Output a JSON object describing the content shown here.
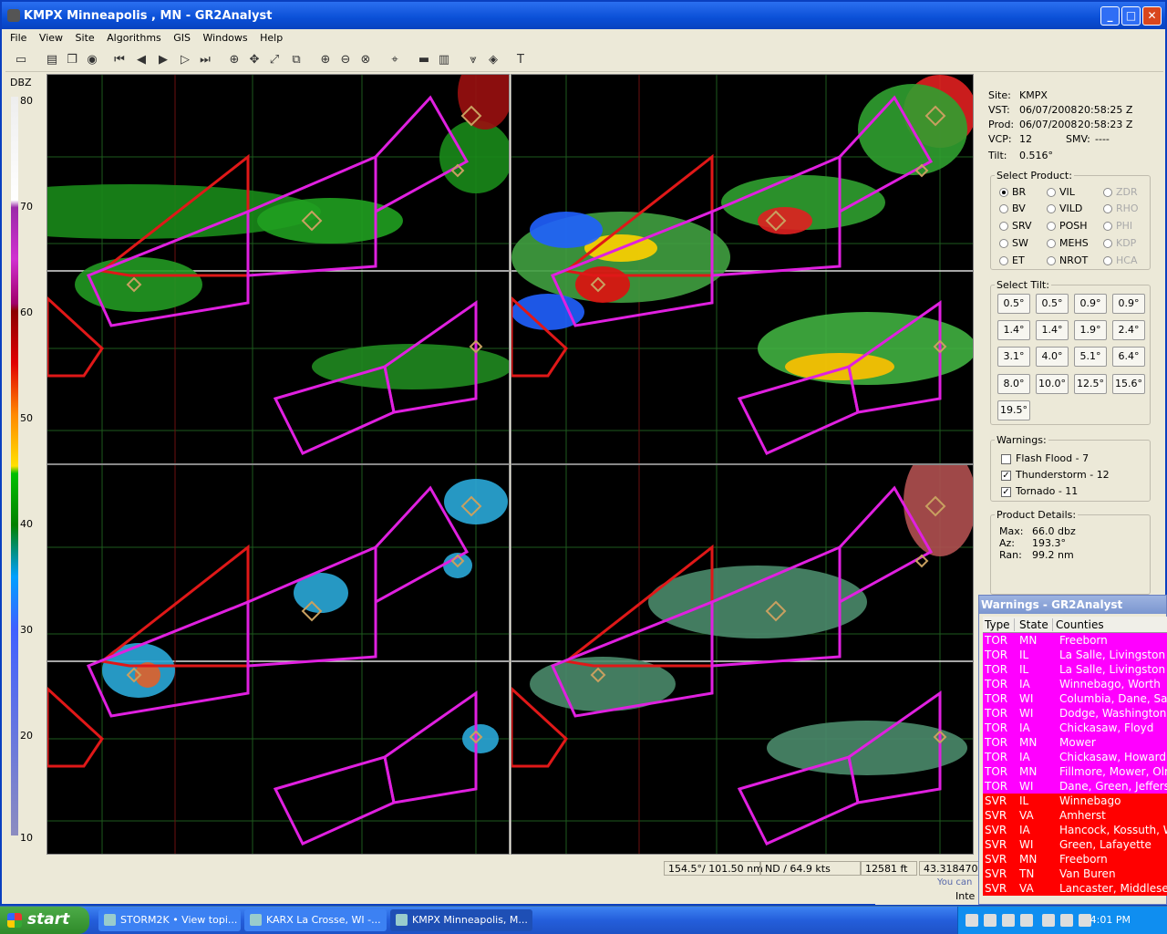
{
  "window": {
    "title": "KMPX Minneapolis , MN - GR2Analyst",
    "btn_min": "_",
    "btn_max": "□",
    "btn_close": "✕"
  },
  "menu": [
    "File",
    "View",
    "Site",
    "Algorithms",
    "GIS",
    "Windows",
    "Help"
  ],
  "scale": {
    "label": "DBZ",
    "ticks": [
      "80",
      "70",
      "60",
      "50",
      "40",
      "30",
      "20",
      "10"
    ]
  },
  "info": {
    "site_label": "Site:",
    "site": "KMPX",
    "vst_label": "VST:",
    "vst_date": "06/07/2008",
    "vst_time": "20:58:25 Z",
    "prod_label": "Prod:",
    "prod_date": "06/07/2008",
    "prod_time": "20:58:23 Z",
    "vcp_label": "VCP:",
    "vcp": "12",
    "smv_label": "SMV:",
    "smv": "----",
    "tilt_label": "Tilt:",
    "tilt": "0.516°"
  },
  "select_product": {
    "label": "Select Product:",
    "items": [
      "BR",
      "VIL",
      "ZDR",
      "BV",
      "VILD",
      "RHO",
      "SRV",
      "POSH",
      "PHI",
      "SW",
      "MEHS",
      "KDP",
      "ET",
      "NROT",
      "HCA"
    ]
  },
  "select_tilt": {
    "label": "Select Tilt:",
    "buttons": [
      "0.5°",
      "0.5°",
      "0.9°",
      "0.9°",
      "1.4°",
      "1.4°",
      "1.9°",
      "2.4°",
      "3.1°",
      "4.0°",
      "5.1°",
      "6.4°",
      "8.0°",
      "10.0°",
      "12.5°",
      "15.6°",
      "19.5°"
    ]
  },
  "warnings": {
    "label": "Warnings:",
    "items": [
      {
        "label": "Flash Flood - 7",
        "checked": false
      },
      {
        "label": "Thunderstorm - 12",
        "checked": true
      },
      {
        "label": "Tornado - 11",
        "checked": true
      }
    ]
  },
  "product_details": {
    "label": "Product Details:",
    "max_label": "Max:",
    "max": "66.0 dbz",
    "az_label": "Az:",
    "az": "193.3°",
    "ran_label": "Ran:",
    "ran": "99.2 nm"
  },
  "status": {
    "azran": "154.5°/ 101.50 nm",
    "nd": "ND / 64.9 kts",
    "ft": "12581 ft",
    "coords": "43.318470,"
  },
  "warn_window": {
    "title": "Warnings - GR2Analyst",
    "headers": [
      "Type",
      "State",
      "Counties"
    ],
    "rows": [
      [
        "TOR",
        "MN",
        "Freeborn"
      ],
      [
        "TOR",
        "IL",
        "La Salle, Livingston"
      ],
      [
        "TOR",
        "IL",
        "La Salle, Livingston"
      ],
      [
        "TOR",
        "IA",
        "Winnebago, Worth"
      ],
      [
        "TOR",
        "WI",
        "Columbia, Dane, Sau"
      ],
      [
        "TOR",
        "WI",
        "Dodge, Washington"
      ],
      [
        "TOR",
        "IA",
        "Chickasaw, Floyd"
      ],
      [
        "TOR",
        "MN",
        "Mower"
      ],
      [
        "TOR",
        "IA",
        "Chickasaw, Howard"
      ],
      [
        "TOR",
        "MN",
        "Fillmore, Mower, Olm"
      ],
      [
        "TOR",
        "WI",
        "Dane, Green, Jeffers"
      ],
      [
        "SVR",
        "IL",
        "Winnebago"
      ],
      [
        "SVR",
        "VA",
        "Amherst"
      ],
      [
        "SVR",
        "IA",
        "Hancock, Kossuth, W"
      ],
      [
        "SVR",
        "WI",
        "Green, Lafayette"
      ],
      [
        "SVR",
        "MN",
        "Freeborn"
      ],
      [
        "SVR",
        "TN",
        "Van Buren"
      ],
      [
        "SVR",
        "VA",
        "Lancaster, Middlesex"
      ]
    ],
    "colors": {
      "TOR": "#ff00ff",
      "SVR": "#ff0000"
    }
  },
  "behind_text": {
    "you_can": "You can",
    "inte": "Inte"
  },
  "taskbar": {
    "start": "start",
    "tasks": [
      "STORM2K • View topi...",
      "KARX La Crosse, WI -...",
      "KMPX Minneapolis, M..."
    ],
    "clock": "4:01 PM"
  }
}
